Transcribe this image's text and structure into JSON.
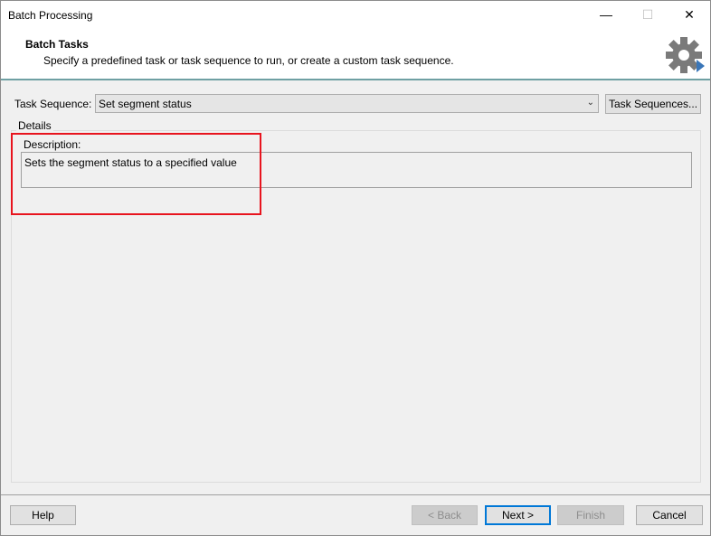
{
  "window": {
    "title": "Batch Processing",
    "controls": {
      "minimize": "—",
      "maximize": "☐",
      "close": "✕"
    }
  },
  "header": {
    "title": "Batch Tasks",
    "subtitle": "Specify a predefined task or task sequence to run, or create a custom task sequence.",
    "icon": "gear-with-arrow-icon"
  },
  "task_sequence": {
    "label": "Task Sequence:",
    "selected": "Set segment status",
    "button_label": "Task Sequences..."
  },
  "details": {
    "group_label": "Details",
    "description_label": "Description:",
    "description_value": "Sets the segment status to a specified value"
  },
  "footer": {
    "help": "Help",
    "back": "< Back",
    "next": "Next >",
    "finish": "Finish",
    "cancel": "Cancel"
  },
  "colors": {
    "highlight": "#e8141e",
    "header_border": "#6fa0a3",
    "gear": "#7a7a7a",
    "gear_arrow": "#3a76b8"
  }
}
